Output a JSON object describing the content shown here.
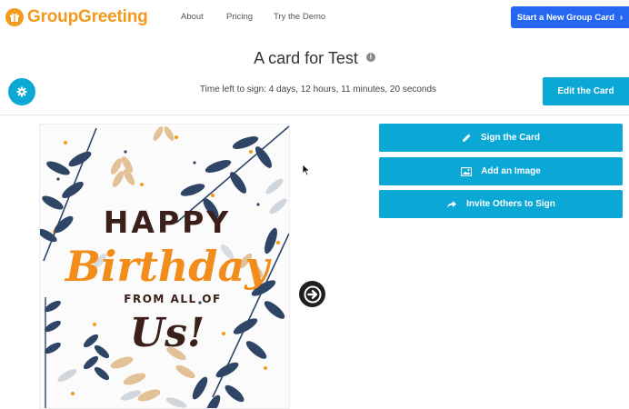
{
  "brand": {
    "name_part1": "Group",
    "name_part2": "Greeting",
    "accent": "#f29a1d"
  },
  "nav": {
    "links": [
      "About",
      "Pricing",
      "Try the Demo"
    ],
    "cta_label": "Start a New Group Card",
    "cta_color": "#2566f2"
  },
  "page": {
    "title": "A card for Test",
    "timer": "Time left to sign: 4 days, 12 hours, 11 minutes, 20 seconds",
    "edit_label": "Edit the Card",
    "button_color": "#0ba8d6"
  },
  "card": {
    "line1": "HAPPY",
    "line2": "Birthday",
    "line3": "FROM ALL OF",
    "line4": "Us!"
  },
  "actions": [
    {
      "label": "Sign the Card",
      "icon": "pencil-icon"
    },
    {
      "label": "Add an Image",
      "icon": "image-icon"
    },
    {
      "label": "Invite Others to Sign",
      "icon": "share-arrow-icon"
    }
  ]
}
